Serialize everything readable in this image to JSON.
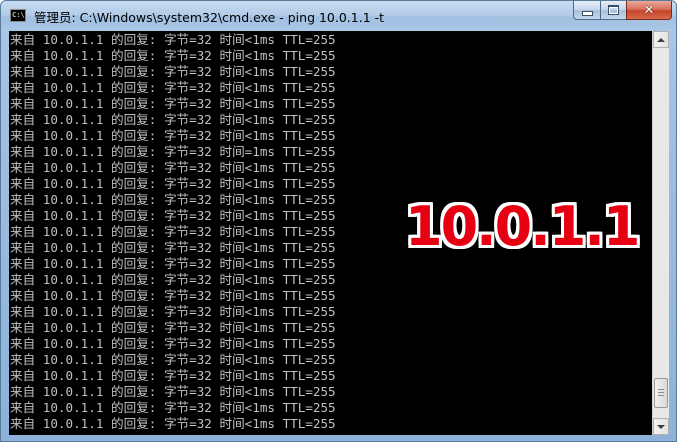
{
  "window": {
    "title": "管理员: C:\\Windows\\system32\\cmd.exe - ping  10.0.1.1 -t",
    "icon_label": "C:\\.",
    "icon": "cmd-console-icon"
  },
  "caption_buttons": {
    "minimize_icon": "minimize-icon",
    "maximize_icon": "maximize-icon",
    "close_label": "✕"
  },
  "console": {
    "background_color": "#000000",
    "text_color": "#c0c0c0",
    "lines": [
      "来自 10.0.1.1 的回复: 字节=32 时间<1ms TTL=255",
      "来自 10.0.1.1 的回复: 字节=32 时间<1ms TTL=255",
      "来自 10.0.1.1 的回复: 字节=32 时间<1ms TTL=255",
      "来自 10.0.1.1 的回复: 字节=32 时间<1ms TTL=255",
      "来自 10.0.1.1 的回复: 字节=32 时间<1ms TTL=255",
      "来自 10.0.1.1 的回复: 字节=32 时间<1ms TTL=255",
      "来自 10.0.1.1 的回复: 字节=32 时间<1ms TTL=255",
      "来自 10.0.1.1 的回复: 字节=32 时间=1ms TTL=255",
      "来自 10.0.1.1 的回复: 字节=32 时间<1ms TTL=255",
      "来自 10.0.1.1 的回复: 字节=32 时间<1ms TTL=255",
      "来自 10.0.1.1 的回复: 字节=32 时间<1ms TTL=255",
      "来自 10.0.1.1 的回复: 字节=32 时间<1ms TTL=255",
      "来自 10.0.1.1 的回复: 字节=32 时间<1ms TTL=255",
      "来自 10.0.1.1 的回复: 字节=32 时间<1ms TTL=255",
      "来自 10.0.1.1 的回复: 字节=32 时间<1ms TTL=255",
      "来自 10.0.1.1 的回复: 字节=32 时间<1ms TTL=255",
      "来自 10.0.1.1 的回复: 字节=32 时间<1ms TTL=255",
      "来自 10.0.1.1 的回复: 字节=32 时间<1ms TTL=255",
      "来自 10.0.1.1 的回复: 字节=32 时间<1ms TTL=255",
      "来自 10.0.1.1 的回复: 字节=32 时间<1ms TTL=255",
      "来自 10.0.1.1 的回复: 字节=32 时间<1ms TTL=255",
      "来自 10.0.1.1 的回复: 字节=32 时间<1ms TTL=255",
      "来自 10.0.1.1 的回复: 字节=32 时间<1ms TTL=255",
      "来自 10.0.1.1 的回复: 字节=32 时间<1ms TTL=255",
      "来自 10.0.1.1 的回复: 字节=32 时间<1ms TTL=255"
    ]
  },
  "scrollbar": {
    "up_icon": "scroll-up-arrow-icon",
    "down_icon": "scroll-down-arrow-icon",
    "position": 0.97
  },
  "overlay": {
    "text": "10.0.1.1",
    "color": "#e60012",
    "outline_color": "#ffffff"
  }
}
